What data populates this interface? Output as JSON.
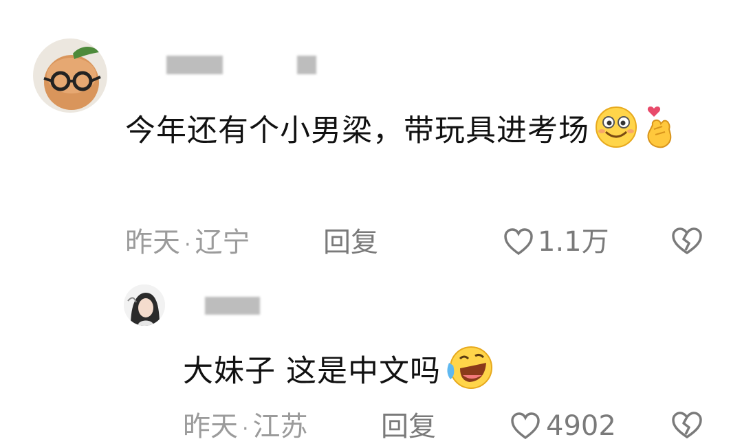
{
  "comments": [
    {
      "avatar": "peach-glasses-avatar",
      "text": "今年还有个小男梁，带玩具进考场",
      "emojis": [
        "smile-emoji",
        "finger-heart-emoji"
      ],
      "time": "昨天",
      "location": "辽宁",
      "reply_label": "回复",
      "likes": "1.1万"
    },
    {
      "avatar": "girl-avatar",
      "text": "大妹子 这是中文吗",
      "emojis": [
        "laugh-cry-emoji"
      ],
      "time": "昨天",
      "location": "江苏",
      "reply_label": "回复",
      "likes": "4902"
    }
  ],
  "separator": "·",
  "icons": {
    "like": "heart-outline-icon",
    "dislike": "broken-heart-icon"
  },
  "colors": {
    "text": "#111111",
    "meta": "#9b9b9b",
    "action": "#7a7a7a",
    "background": "#ffffff"
  }
}
